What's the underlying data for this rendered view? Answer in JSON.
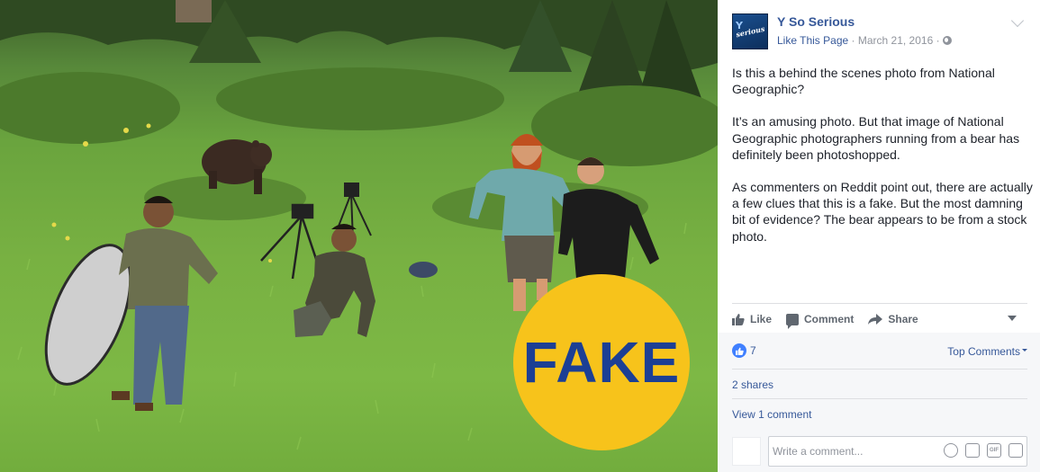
{
  "photo": {
    "badge_text": "FAKE",
    "badge_color": "#f7c31b",
    "badge_text_color": "#1c3f94"
  },
  "post": {
    "page_name": "Y So Serious",
    "logo_text": "serious",
    "like_page": "Like This Page",
    "date": "March 21, 2016",
    "separator": "·",
    "paragraphs": [
      "Is this a behind the scenes photo from National Geographic?",
      "It’s an amusing photo. But that image of National Geographic photographers running from a bear has definitely been photoshopped.",
      "As commenters on Reddit point out, there are actually a few clues that this is a fake. But the most damning bit of evidence? The bear appears to be from a stock photo."
    ]
  },
  "actions": {
    "like": "Like",
    "comment": "Comment",
    "share": "Share"
  },
  "stats": {
    "likes_count": "7",
    "top_comments": "Top Comments",
    "shares": "2 shares",
    "view_comments": "View 1 comment"
  },
  "comment_box": {
    "placeholder": "Write a comment...",
    "icons": [
      "emoji-icon",
      "camera-icon",
      "gif-icon",
      "sticker-icon"
    ],
    "gif_label": "GIF"
  },
  "colors": {
    "link": "#365899",
    "meta": "#90949c",
    "like_blue": "#4080ff"
  }
}
